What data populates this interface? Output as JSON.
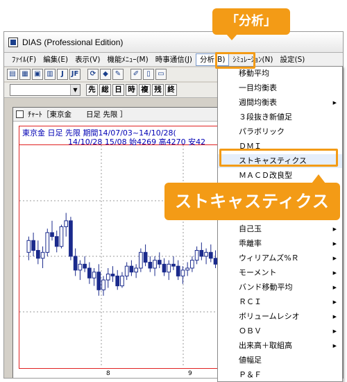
{
  "app": {
    "title": "DIAS (Professional Edition)"
  },
  "menubar": {
    "items": [
      {
        "label": "ﾌｧｲﾙ(F)"
      },
      {
        "label": "編集(E)"
      },
      {
        "label": "表示(V)"
      },
      {
        "label": "機能ﾒﾆｭｰ(M)"
      },
      {
        "label": "時事通信(J)"
      },
      {
        "label": "分析(B)"
      },
      {
        "label": "ｼﾐｭﾚｰｼｮﾝ(N)"
      },
      {
        "label": "設定(S)"
      }
    ]
  },
  "toolbar": {
    "icons": [
      "chart-icon",
      "chart-icon",
      "list-icon",
      "table-icon",
      "j-icon",
      "jf-icon",
      "refresh-icon",
      "tag-icon",
      "pen-icon",
      "edit-icon",
      "page-icon",
      "window-icon"
    ],
    "icon_glyphs": [
      "▤",
      "▦",
      "▣",
      "▥",
      "J",
      "JF",
      "⟳",
      "◆",
      "✎",
      "✐",
      "▯",
      "▭"
    ]
  },
  "toolbar2": {
    "combo_value": "",
    "buttons": [
      "先",
      "総",
      "日",
      "時",
      "複",
      "残",
      "終"
    ]
  },
  "chart_window": {
    "title": "ﾁｬｰﾄ［東京金　　日足 先限 ］",
    "info_line1": "東京金 日足 先限 期間14/07/03~14/10/28(",
    "info_line2": "14/10/28 15/08 始4269 高4270 安42",
    "x_labels": [
      "8",
      "9"
    ]
  },
  "dropdown": {
    "items": [
      {
        "label": "移動平均",
        "sub": false
      },
      {
        "label": "一目均衡表",
        "sub": false
      },
      {
        "label": "週間均衡表",
        "sub": true
      },
      {
        "label": "３段抜き新値足",
        "sub": false
      },
      {
        "label": "パラボリック",
        "sub": false
      },
      {
        "label": "ＤＭＩ",
        "sub": false
      },
      {
        "label": "ストキャスティクス",
        "sub": false
      },
      {
        "label": "ＭＡＣＤ改良型",
        "sub": false
      },
      {
        "label": "",
        "sub": false
      },
      {
        "label": "",
        "sub": false
      },
      {
        "label": "自己玉",
        "sub": true
      },
      {
        "label": "乖離率",
        "sub": true
      },
      {
        "label": "ウィリアムズ%Ｒ",
        "sub": true
      },
      {
        "label": "モーメント",
        "sub": true
      },
      {
        "label": "バンド移動平均",
        "sub": true
      },
      {
        "label": "ＲＣＩ",
        "sub": true
      },
      {
        "label": "ボリュームレシオ",
        "sub": true
      },
      {
        "label": "ＯＢＶ",
        "sub": true
      },
      {
        "label": "出来高＋取組高",
        "sub": true
      },
      {
        "label": "値幅足",
        "sub": false
      },
      {
        "label": "Ｐ＆Ｆ",
        "sub": false
      }
    ]
  },
  "callouts": {
    "menu_callout": "「分析」",
    "item_callout": "ストキャスティクス"
  },
  "colors": {
    "accent": "#f39b16",
    "candle": "#1a2a8c",
    "info_text": "#0000b4"
  },
  "chart_data": {
    "type": "candlestick",
    "title": "",
    "x_tick_labels": [
      "8",
      "9"
    ],
    "y_range": [
      0,
      100
    ],
    "candles": [
      [
        52,
        60,
        48,
        58
      ],
      [
        58,
        62,
        50,
        53
      ],
      [
        53,
        58,
        46,
        49
      ],
      [
        49,
        55,
        44,
        52
      ],
      [
        52,
        64,
        50,
        62
      ],
      [
        62,
        68,
        58,
        60
      ],
      [
        60,
        63,
        52,
        55
      ],
      [
        55,
        66,
        54,
        65
      ],
      [
        65,
        72,
        60,
        68
      ],
      [
        68,
        70,
        48,
        50
      ],
      [
        50,
        54,
        40,
        43
      ],
      [
        43,
        48,
        38,
        46
      ],
      [
        46,
        50,
        42,
        44
      ],
      [
        44,
        47,
        36,
        39
      ],
      [
        39,
        44,
        35,
        42
      ],
      [
        42,
        46,
        30,
        33
      ],
      [
        33,
        40,
        30,
        38
      ],
      [
        38,
        44,
        34,
        41
      ],
      [
        41,
        45,
        37,
        40
      ],
      [
        40,
        43,
        33,
        35
      ],
      [
        35,
        42,
        34,
        40
      ],
      [
        40,
        47,
        38,
        45
      ],
      [
        45,
        48,
        40,
        42
      ],
      [
        42,
        46,
        39,
        44
      ],
      [
        44,
        54,
        42,
        52
      ],
      [
        52,
        56,
        45,
        47
      ],
      [
        47,
        50,
        42,
        44
      ],
      [
        44,
        50,
        40,
        48
      ],
      [
        48,
        52,
        44,
        46
      ],
      [
        46,
        49,
        40,
        42
      ],
      [
        42,
        48,
        38,
        46
      ],
      [
        46,
        50,
        43,
        45
      ],
      [
        45,
        48,
        38,
        40
      ],
      [
        40,
        45,
        36,
        43
      ],
      [
        43,
        47,
        40,
        44
      ],
      [
        44,
        50,
        42,
        48
      ],
      [
        48,
        55,
        46,
        53
      ],
      [
        53,
        57,
        48,
        50
      ],
      [
        50,
        54,
        46,
        52
      ],
      [
        52,
        56,
        47,
        49
      ],
      [
        49,
        53,
        44,
        46
      ],
      [
        46,
        51,
        43,
        50
      ],
      [
        50,
        55,
        47,
        54
      ],
      [
        54,
        58,
        49,
        51
      ],
      [
        51,
        54,
        46,
        48
      ],
      [
        48,
        52,
        45,
        50
      ],
      [
        50,
        53,
        46,
        47
      ],
      [
        47,
        50,
        42,
        44
      ]
    ]
  }
}
